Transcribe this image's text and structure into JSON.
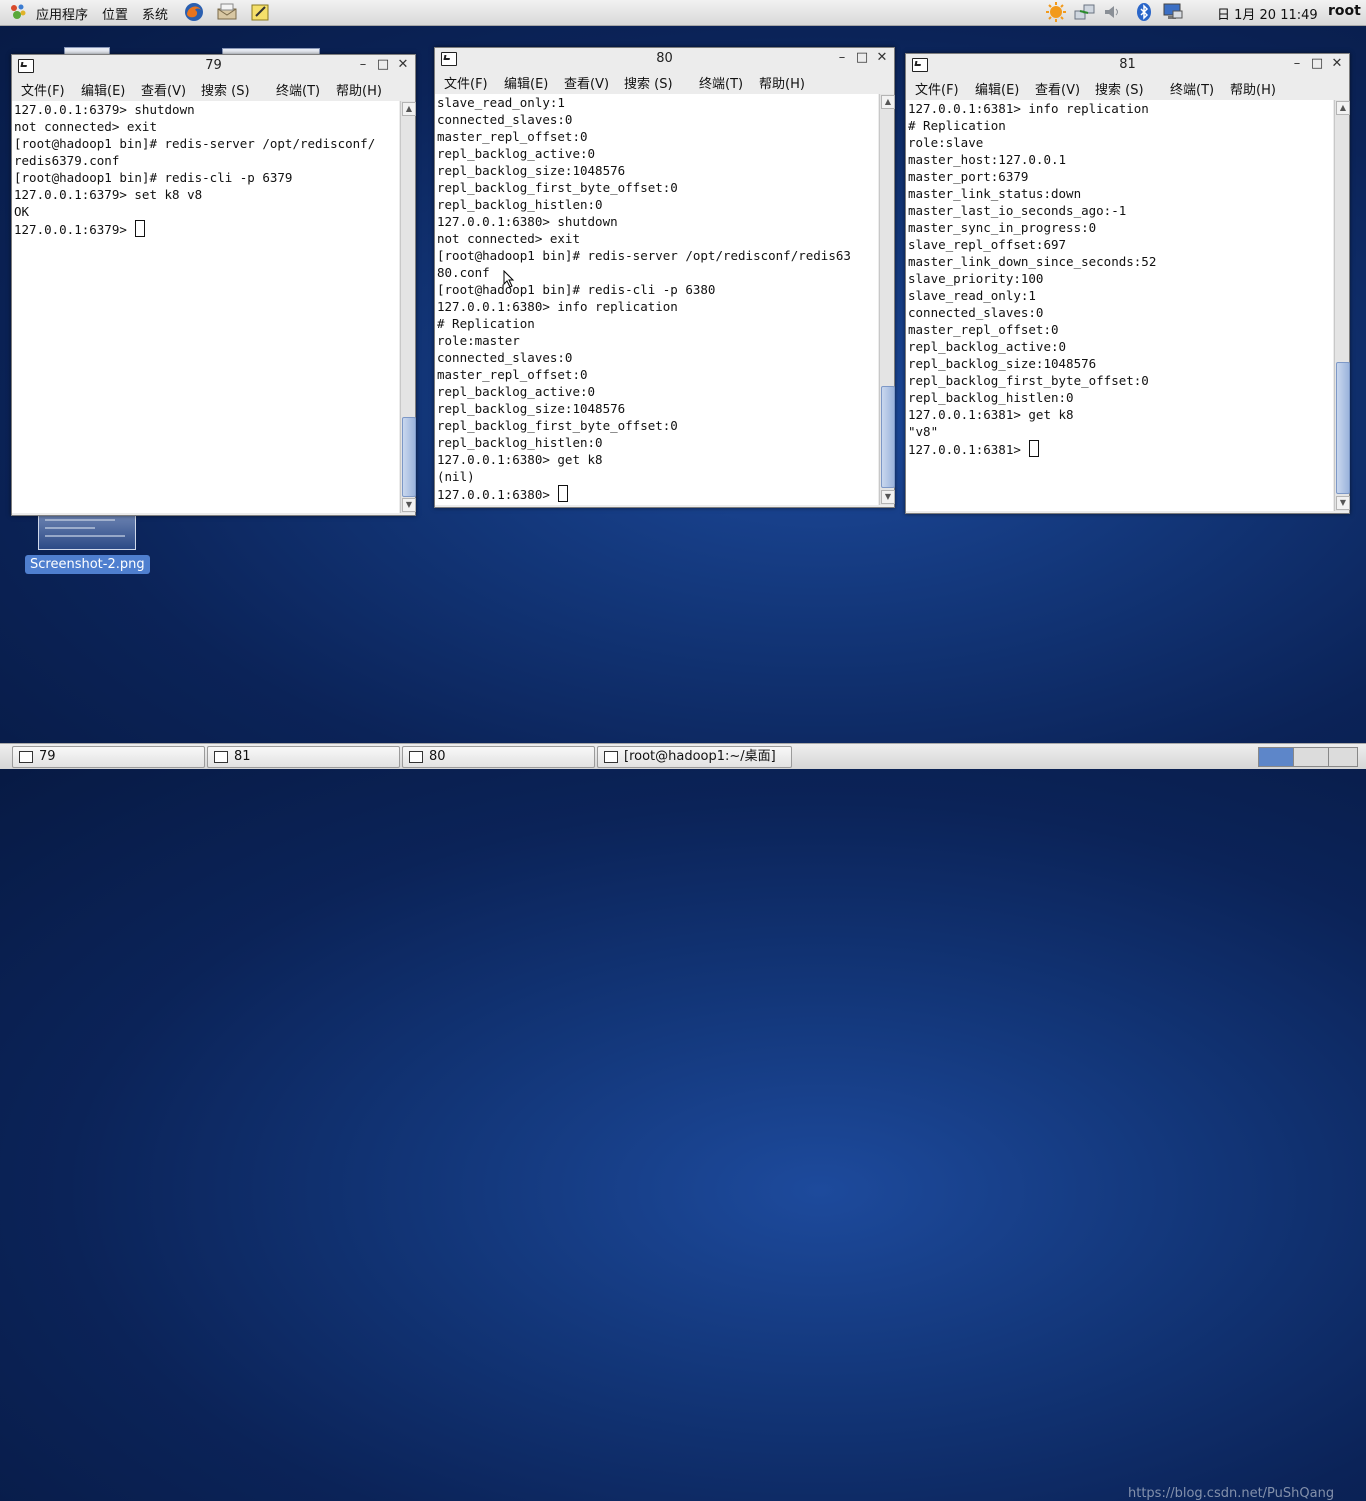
{
  "top_panel": {
    "menus": [
      "应用程序",
      "位置",
      "系统"
    ],
    "clock": "日  1月 20 11:49",
    "user": "root"
  },
  "desktop": {
    "icon_label": "Screenshot-2.png"
  },
  "windows": [
    {
      "title": "79",
      "menu": [
        "文件(F)",
        "编辑(E)",
        "查看(V)",
        "搜索 (S)",
        "终端(T)",
        "帮助(H)"
      ],
      "lines": [
        "127.0.0.1:6379> shutdown",
        "not connected> exit",
        "[root@hadoop1 bin]# redis-server /opt/redisconf/",
        "redis6379.conf",
        "[root@hadoop1 bin]# redis-cli -p 6379",
        "127.0.0.1:6379> set k8 v8",
        "OK",
        "127.0.0.1:6379> "
      ]
    },
    {
      "title": "80",
      "menu": [
        "文件(F)",
        "编辑(E)",
        "查看(V)",
        "搜索 (S)",
        "终端(T)",
        "帮助(H)"
      ],
      "lines": [
        "slave_read_only:1",
        "connected_slaves:0",
        "master_repl_offset:0",
        "repl_backlog_active:0",
        "repl_backlog_size:1048576",
        "repl_backlog_first_byte_offset:0",
        "repl_backlog_histlen:0",
        "127.0.0.1:6380> shutdown",
        "not connected> exit",
        "[root@hadoop1 bin]# redis-server /opt/redisconf/redis63",
        "80.conf",
        "[root@hadoop1 bin]# redis-cli -p 6380",
        "127.0.0.1:6380> info replication",
        "# Replication",
        "role:master",
        "connected_slaves:0",
        "master_repl_offset:0",
        "repl_backlog_active:0",
        "repl_backlog_size:1048576",
        "repl_backlog_first_byte_offset:0",
        "repl_backlog_histlen:0",
        "127.0.0.1:6380> get k8",
        "(nil)",
        "127.0.0.1:6380> "
      ]
    },
    {
      "title": "81",
      "menu": [
        "文件(F)",
        "编辑(E)",
        "查看(V)",
        "搜索 (S)",
        "终端(T)",
        "帮助(H)"
      ],
      "lines": [
        "127.0.0.1:6381> info replication",
        "# Replication",
        "role:slave",
        "master_host:127.0.0.1",
        "master_port:6379",
        "master_link_status:down",
        "master_last_io_seconds_ago:-1",
        "master_sync_in_progress:0",
        "slave_repl_offset:697",
        "master_link_down_since_seconds:52",
        "slave_priority:100",
        "slave_read_only:1",
        "connected_slaves:0",
        "master_repl_offset:0",
        "repl_backlog_active:0",
        "repl_backlog_size:1048576",
        "repl_backlog_first_byte_offset:0",
        "repl_backlog_histlen:0",
        "127.0.0.1:6381> get k8",
        "\"v8\"",
        "127.0.0.1:6381> "
      ]
    }
  ],
  "taskbar": {
    "tasks": [
      "79",
      "81",
      "80",
      "[root@hadoop1:~/桌面]"
    ],
    "watermark": "https://blog.csdn.net/PuShQang"
  },
  "colors": {
    "desktop": "#123577",
    "scroll_thumb": "#9bb4dc",
    "icon_label_bg": "#4f7fcf"
  }
}
